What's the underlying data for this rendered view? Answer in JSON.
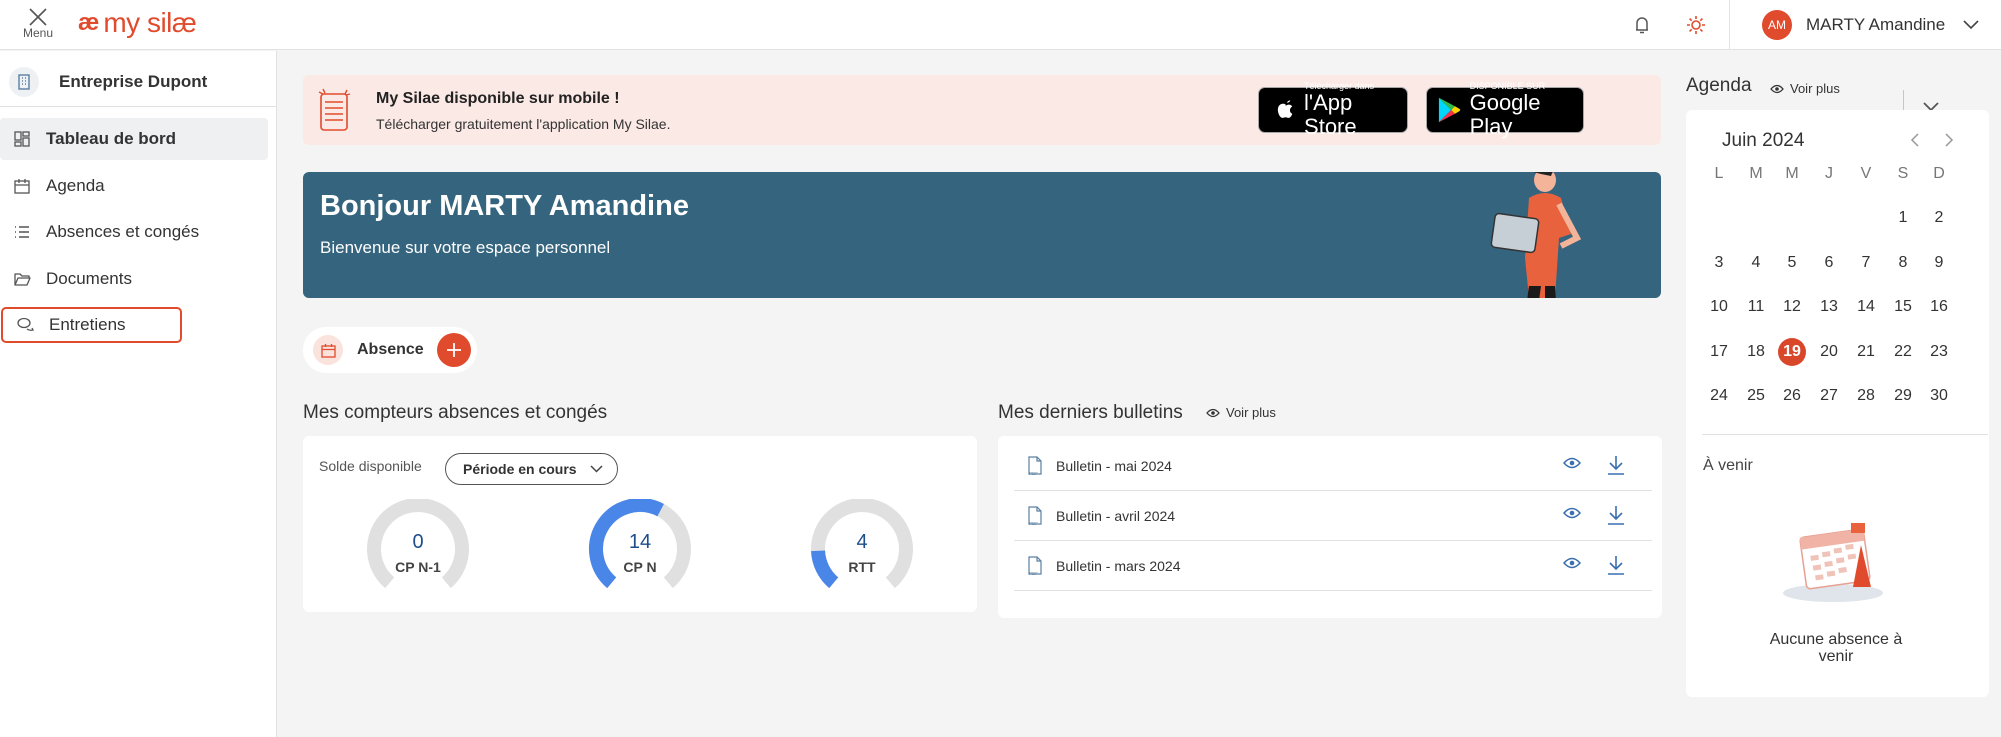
{
  "header": {
    "menu_label": "Menu",
    "logo_text": "my silæ",
    "user_initials": "AM",
    "user_name": "MARTY Amandine",
    "accent": "#e14b2d"
  },
  "sidebar": {
    "company": "Entreprise Dupont",
    "items": [
      {
        "label": "Tableau de bord",
        "icon": "dashboard-icon",
        "active": true
      },
      {
        "label": "Agenda",
        "icon": "calendar-icon"
      },
      {
        "label": "Absences et congés",
        "icon": "list-icon"
      },
      {
        "label": "Documents",
        "icon": "folder-icon"
      },
      {
        "label": "Entretiens",
        "icon": "chat-icon",
        "highlighted": true
      }
    ]
  },
  "mobile_banner": {
    "title": "My Silae disponible sur mobile !",
    "subtitle": "Télécharger gratuitement l'application My Silae.",
    "appstore_small": "Télécharger dans",
    "appstore_big": "l'App Store",
    "googleplay_small": "DISPONIBLE SUR",
    "googleplay_big": "Google Play"
  },
  "welcome": {
    "title": "Bonjour MARTY Amandine",
    "subtitle": "Bienvenue sur votre espace personnel",
    "color": "#35647e"
  },
  "absence_chip": {
    "label": "Absence"
  },
  "counters": {
    "title": "Mes compteurs absences et congés",
    "solde_label": "Solde disponible",
    "period": "Période en cours",
    "gauges": [
      {
        "value": "0",
        "label": "CP N-1",
        "fill": 0
      },
      {
        "value": "14",
        "label": "CP N",
        "fill": 0.6
      },
      {
        "value": "4",
        "label": "RTT",
        "fill": 0.17
      }
    ]
  },
  "bulletins": {
    "title": "Mes derniers bulletins",
    "voir_plus": "Voir plus",
    "items": [
      "Bulletin - mai 2024",
      "Bulletin - avril 2024",
      "Bulletin - mars 2024"
    ]
  },
  "agenda": {
    "title": "Agenda",
    "voir_plus": "Voir plus",
    "month": "Juin 2024",
    "weekdays": [
      "L",
      "M",
      "M",
      "J",
      "V",
      "S",
      "D"
    ],
    "weeks": [
      [
        "",
        "",
        "",
        "",
        "",
        "1",
        "2"
      ],
      [
        "3",
        "4",
        "5",
        "6",
        "7",
        "8",
        "9"
      ],
      [
        "10",
        "11",
        "12",
        "13",
        "14",
        "15",
        "16"
      ],
      [
        "17",
        "18",
        "19",
        "20",
        "21",
        "22",
        "23"
      ],
      [
        "24",
        "25",
        "26",
        "27",
        "28",
        "29",
        "30"
      ]
    ],
    "today": "19",
    "upcoming_title": "À venir",
    "empty_text": "Aucune absence à venir"
  }
}
